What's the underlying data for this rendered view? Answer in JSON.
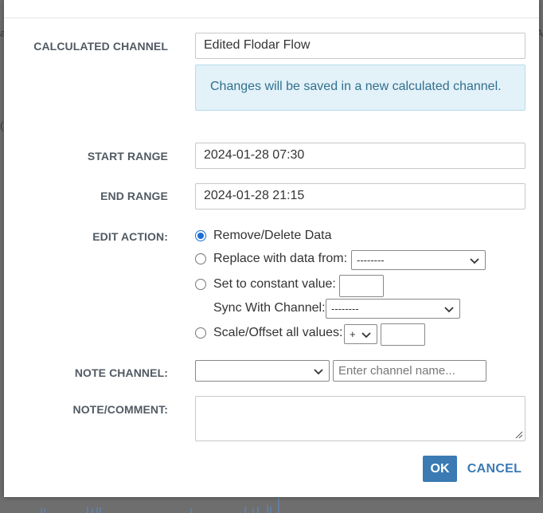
{
  "fields": {
    "calculated_channel": {
      "label": "CALCULATED CHANNEL",
      "value": "Edited Flodar Flow"
    },
    "info_message": "Changes will be saved in a new calculated channel.",
    "start_range": {
      "label": "START RANGE",
      "value": "2024-01-28 07:30"
    },
    "end_range": {
      "label": "END RANGE",
      "value": "2024-01-28 21:15"
    }
  },
  "edit_action": {
    "label": "EDIT ACTION:",
    "options": {
      "remove": "Remove/Delete Data",
      "replace": "Replace with data from:",
      "constant": "Set to constant value:",
      "scale": "Scale/Offset all values:"
    },
    "selected": "remove",
    "replace_select_value": "--------",
    "sync_label": "Sync With Channel:",
    "sync_select_value": "--------",
    "operator_value": "+"
  },
  "note_channel": {
    "label": "NOTE CHANNEL:",
    "select_value": "",
    "placeholder": "Enter channel name..."
  },
  "note_comment": {
    "label": "NOTE/COMMENT:",
    "value": ""
  },
  "buttons": {
    "ok": "OK",
    "cancel": "CANCEL"
  },
  "colors": {
    "accent": "#3b7ab3",
    "info_bg": "#e3f1f8",
    "info_text": "#31708f",
    "radio_selected": "#1a6fd6"
  }
}
